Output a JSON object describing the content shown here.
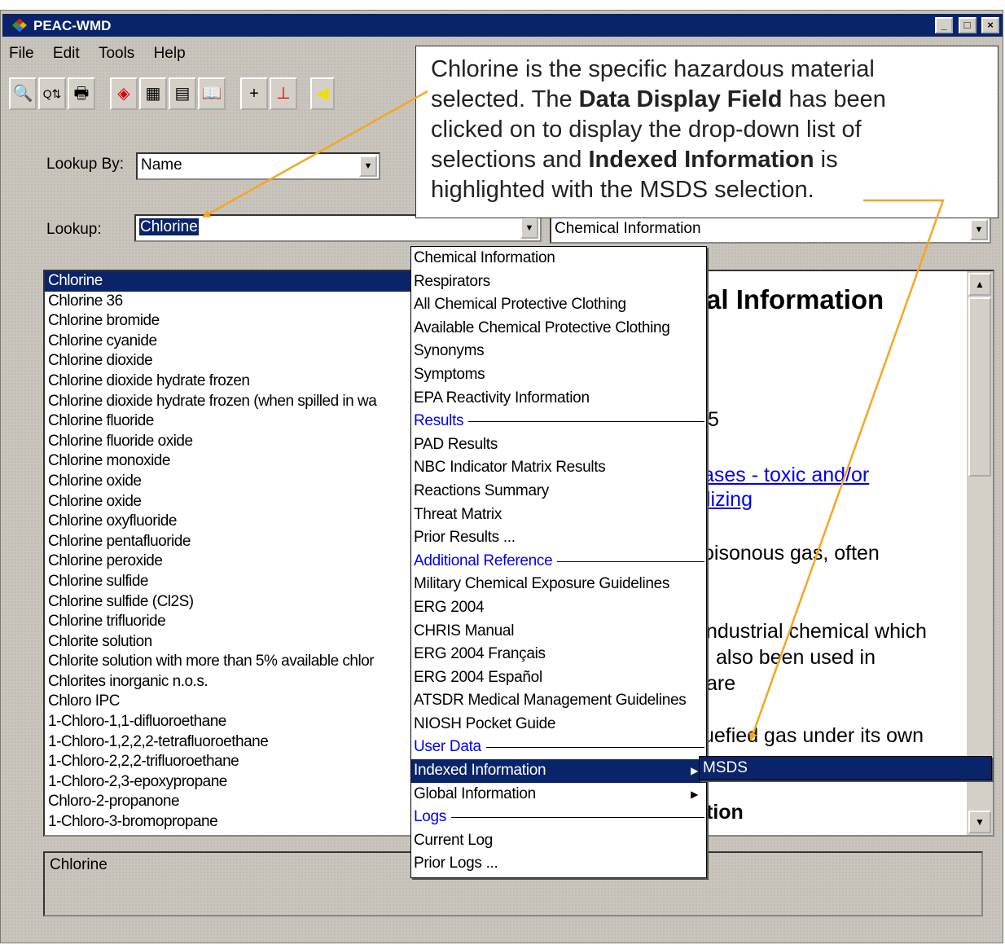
{
  "window": {
    "title": "PEAC-WMD",
    "minimize": "_",
    "maximize": "□",
    "close": "×"
  },
  "menubar": [
    "File",
    "Edit",
    "Tools",
    "Help"
  ],
  "lookup_by": {
    "label": "Lookup By:",
    "value": "Name"
  },
  "lookup": {
    "label": "Lookup:",
    "value": "Chlorine"
  },
  "display_field": {
    "value": "Chemical Information"
  },
  "material_list": [
    "Chlorine",
    "Chlorine 36",
    "Chlorine bromide",
    "Chlorine cyanide",
    "Chlorine dioxide",
    "Chlorine dioxide hydrate frozen",
    "Chlorine dioxide hydrate frozen (when spilled in wa",
    "Chlorine fluoride",
    "Chlorine fluoride oxide",
    "Chlorine monoxide",
    "Chlorine oxide",
    "Chlorine oxide",
    "Chlorine oxyfluoride",
    "Chlorine pentafluoride",
    "Chlorine peroxide",
    "Chlorine sulfide",
    "Chlorine sulfide (Cl2S)",
    "Chlorine trifluoride",
    "Chlorite solution",
    "Chlorite solution with more than 5% available chlor",
    "Chlorites inorganic n.o.s.",
    "Chloro IPC",
    "1-Chloro-1,1-difluoroethane",
    "1-Chloro-1,2,2,2-tetrafluoroethane",
    "1-Chloro-2,2,2-trifluoroethane",
    "1-Chloro-2,3-epoxypropane",
    "Chloro-2-propanone",
    "1-Chloro-3-bromopropane"
  ],
  "content_partial": {
    "heading": "al Information",
    "num": "5",
    "link1": "ases - toxic and/or",
    "link2": "lizing",
    "t1": "oisonous gas, often",
    "t2": "ndustrial chemical which",
    "t3": "also been used in",
    "t4": "are",
    "t5": "uefied gas under its own",
    "heading2": "tion"
  },
  "dropdown_menu": [
    {
      "label": "Chemical Information"
    },
    {
      "label": "Respirators"
    },
    {
      "label": "All Chemical Protective Clothing"
    },
    {
      "label": "Available Chemical Protective Clothing"
    },
    {
      "label": "Synonyms"
    },
    {
      "label": "Symptoms"
    },
    {
      "label": "EPA Reactivity Information"
    },
    {
      "label": "Results",
      "section": true
    },
    {
      "label": "PAD Results"
    },
    {
      "label": "NBC Indicator Matrix Results"
    },
    {
      "label": "Reactions Summary"
    },
    {
      "label": "Threat Matrix"
    },
    {
      "label": "Prior Results ..."
    },
    {
      "label": "Additional Reference",
      "section": true
    },
    {
      "label": "Military Chemical Exposure Guidelines"
    },
    {
      "label": "ERG 2004"
    },
    {
      "label": "CHRIS Manual"
    },
    {
      "label": "ERG 2004 Français"
    },
    {
      "label": "ERG 2004 Español"
    },
    {
      "label": "ATSDR Medical Management Guidelines"
    },
    {
      "label": "NIOSH Pocket Guide"
    },
    {
      "label": "User Data",
      "section": true
    },
    {
      "label": "Indexed Information",
      "highlighted": true,
      "submenu": true
    },
    {
      "label": "Global Information",
      "submenu": true
    },
    {
      "label": "Logs",
      "section": true
    },
    {
      "label": "Current Log"
    },
    {
      "label": "Prior Logs ..."
    }
  ],
  "submenu_item": "MSDS",
  "status_text": "Chlorine",
  "callout": {
    "line1": "Chlorine is the specific hazardous material",
    "line2a": "selected.  The ",
    "line2b": "Data Display Field",
    "line2c": " has been",
    "line3": "clicked on to display the drop-down list of",
    "line4a": "selections and ",
    "line4b": "Indexed Information",
    "line4c": " is",
    "line5": "highlighted with the MSDS selection."
  },
  "colors": {
    "selection": "#0a246a",
    "link": "#0000ee",
    "annotation_arrow": "#f5a623"
  }
}
